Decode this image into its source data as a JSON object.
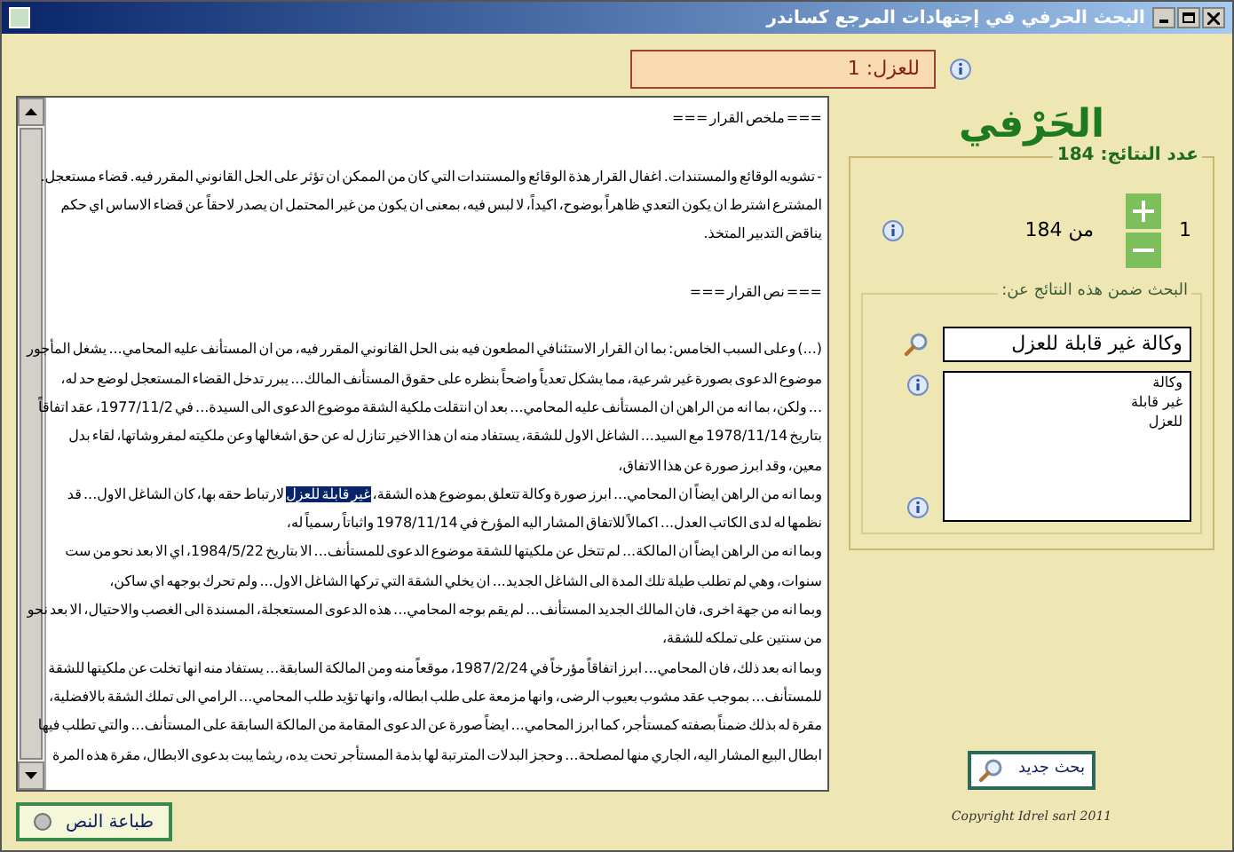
{
  "window": {
    "title": "البحث الحرفي في إجتهادات المرجع كساندر"
  },
  "match_label": "للعزل: 1",
  "document": {
    "lines": [
      {
        "text": "=== ملخص القرار ==="
      },
      {
        "space_before": true,
        "text": "- تشويه الوقائع والمستندات. اغفال القرار هذة الوقائع والمستندات التي كان من الممكن ان تؤثر على الحل القانوني المقرر فيه. قضاء مستعجل."
      },
      {
        "text": "المشترع اشترط ان يكون التعدي ظاهراً بوضوح، اكيداً، لا لبس فيه، بمعنى ان يكون من غير المحتمل ان يصدر لاحقاً عن قضاء الاساس اي حكم"
      },
      {
        "text": "يناقض التدبير المتخذ."
      },
      {
        "space_before": true,
        "text": "=== نص القرار ==="
      },
      {
        "space_before": true,
        "text": "(...) وعلى السبب الخامس: بما ان القرار الاستئنافي المطعون فيه بنى الحل القانوني المقرر فيه، من ان المستأنف عليه المحامي... يشغل المأجور"
      },
      {
        "text": "موضوع الدعوى بصورة غير شرعية، مما يشكل تعدياً واضحاً بنظره على حقوق المستأنف المالك... يبرر تدخل القضاء المستعجل لوضع حد له،"
      },
      {
        "text": "... ولكن، بما انه من الراهن ان المستأنف عليه المحامي... بعد ان انتقلت ملكية الشقة موضوع الدعوى الى السيدة... في 1977/11/2، عقد اتفاقاً"
      },
      {
        "text": "بتاريخ 1978/11/14 مع السيد... الشاغل الاول للشقة، يستفاد منه ان هذا الاخير تنازل له عن حق اشغالها وعن ملكيته لمفروشاتها، لقاء بدل"
      },
      {
        "text": "معين، وقد ابرز صورة عن هذا الاتفاق،"
      },
      {
        "parts": [
          {
            "text": "وبما انه من الراهن ايضاً ان المحامي... ابرز صورة وكالة تتعلق بموضوع هذه الشقة، ",
            "highlighted": false
          },
          {
            "text": "غير قابلة للعزل",
            "highlighted": true
          },
          {
            "text": " لارتباط حقه بها، كان الشاغل الاول... قد",
            "highlighted": false
          }
        ]
      },
      {
        "text": "نظمها له لدى الكاتب العدل... اكمالاً للاتفاق المشار اليه المؤرخ في 1978/11/14 واثباتاً رسمياً له،"
      },
      {
        "text": "وبما انه من الراهن ايضاً ان المالكة... لم تتخل عن ملكيتها للشقة موضوع الدعوى للمستأنف... الا بتاريخ 1984/5/22، اي الا بعد نحو من ست"
      },
      {
        "text": "سنوات، وهي لم تطلب طيلة تلك المدة الى الشاغل الجديد... ان يخلي الشقة التي تركها الشاغل الاول... ولم تحرك بوجهه اي ساكن،"
      },
      {
        "text": "وبما انه من جهة اخرى، فان المالك الجديد المستأنف... لم يقم بوجه المحامي... هذه الدعوى المستعجلة، المسندة الى الغصب والاحتيال، الا بعد نحو"
      },
      {
        "text": "من سنتين على تملكه للشقة،"
      },
      {
        "text": "وبما انه بعد ذلك، فان المحامي... ابرز اتفاقاً مؤرخاً في 1987/2/24، موقعاً منه ومن المالكة السابقة... يستفاد منه انها تخلت عن ملكيتها للشقة"
      },
      {
        "text": "للمستأنف... بموجب عقد مشوب بعيوب الرضى، وانها مزمعة على طلب ابطاله، وانها تؤيد طلب المحامي... الرامي الى تملك الشقة بالافضلية،"
      },
      {
        "text": "مقرة له بذلك ضمناً بصفته كمستأجر، كما ابرز المحامي... ايضاً صورة عن الدعوى المقامة من المالكة السابقة على المستأنف... والتي تطلب فيها"
      },
      {
        "text": "ابطال البيع المشار اليه، الجاري منها لمصلحة... وحجز البدلات المترتبة لها بذمة المستأجر تحت يده، ريثما يبت بدعوى الابطال، مقرة هذه المرة"
      }
    ]
  },
  "print_button": "طباعة النص",
  "sidebar": {
    "title": "الحَرْفي",
    "results_count": "عدد النتائج: 184",
    "current": "1",
    "total": "من 184",
    "refine": {
      "legend": "البحث ضمن هذه النتائج عن:",
      "query": "وكالة غير قابلة للعزل",
      "terms": [
        "وكالة",
        "غير قابلة",
        "للعزل"
      ]
    },
    "new_search_button": "بحث جديد",
    "copyright": "Copyright Idrel sarl 2011"
  }
}
